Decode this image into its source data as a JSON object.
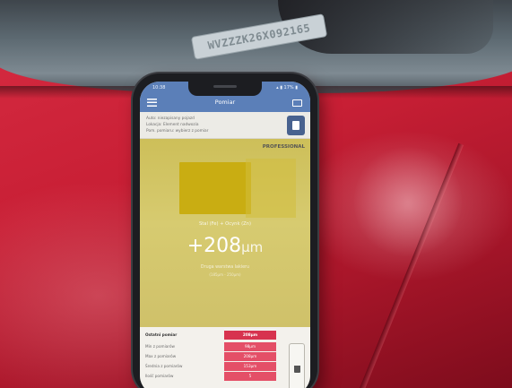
{
  "photo": {
    "vin_plate": "WVZZZK26X092165"
  },
  "phone": {
    "status": {
      "time": "10:38",
      "system": "▴ ▮ 17% ▮"
    },
    "app": {
      "title": "Pomiar",
      "info_lines": [
        "Auto: niezapisany pojazd",
        "Lokacja: Element nadwozia",
        "Pom. pomiaru: wybierz z pomiar"
      ],
      "edition": "PROFESSIONAL",
      "result": {
        "material": "Stal (Fe) + Ocynk (Zn)",
        "value": "+208",
        "unit": "μm",
        "verdict": "Druga warstwa lakieru",
        "range": "(185μm - 250μm)"
      },
      "table": {
        "header_label": "Ostatni pomiar",
        "header_value": "208μm",
        "rows": [
          {
            "label": "Min z pomiarów",
            "value": "98μm"
          },
          {
            "label": "Max z pomiarów",
            "value": "208μm"
          },
          {
            "label": "Średnia z pomiarów",
            "value": "153μm"
          },
          {
            "label": "Ilość pomiarów",
            "value": "5"
          }
        ]
      }
    }
  },
  "colors": {
    "car_red": "#c81f35",
    "app_bar": "#5b7fb8",
    "result_yellow": "#cdbf59",
    "value_pink": "#e44f67"
  },
  "icons": [
    "menu-icon",
    "tablet-icon",
    "document-icon",
    "trash-icon"
  ]
}
